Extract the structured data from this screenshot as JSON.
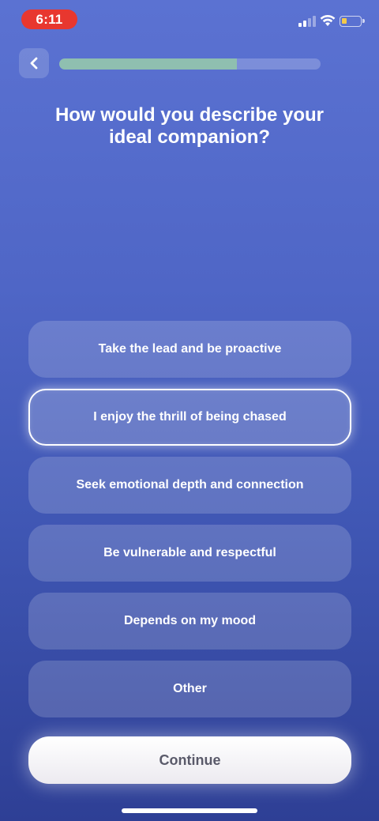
{
  "status_bar": {
    "time": "6:11",
    "time_pill_color": "#e8372f",
    "icons": [
      "signal-icon",
      "wifi-icon",
      "battery-icon"
    ],
    "battery_level": 0.25
  },
  "header": {
    "back_icon": "chevron-left-icon",
    "progress": 0.68
  },
  "question": "How would you describe your ideal companion?",
  "options": [
    {
      "label": "Take the lead and be proactive",
      "selected": false
    },
    {
      "label": "I enjoy the thrill of being chased",
      "selected": true
    },
    {
      "label": "Seek emotional depth and connection",
      "selected": false
    },
    {
      "label": "Be vulnerable and respectful",
      "selected": false
    },
    {
      "label": "Depends on my mood",
      "selected": false
    },
    {
      "label": "Other",
      "selected": false
    }
  ],
  "continue_label": "Continue",
  "colors": {
    "background_top": "#5b72d2",
    "background_bottom": "#2e3f95",
    "progress_fill": "#8fbfb0"
  }
}
